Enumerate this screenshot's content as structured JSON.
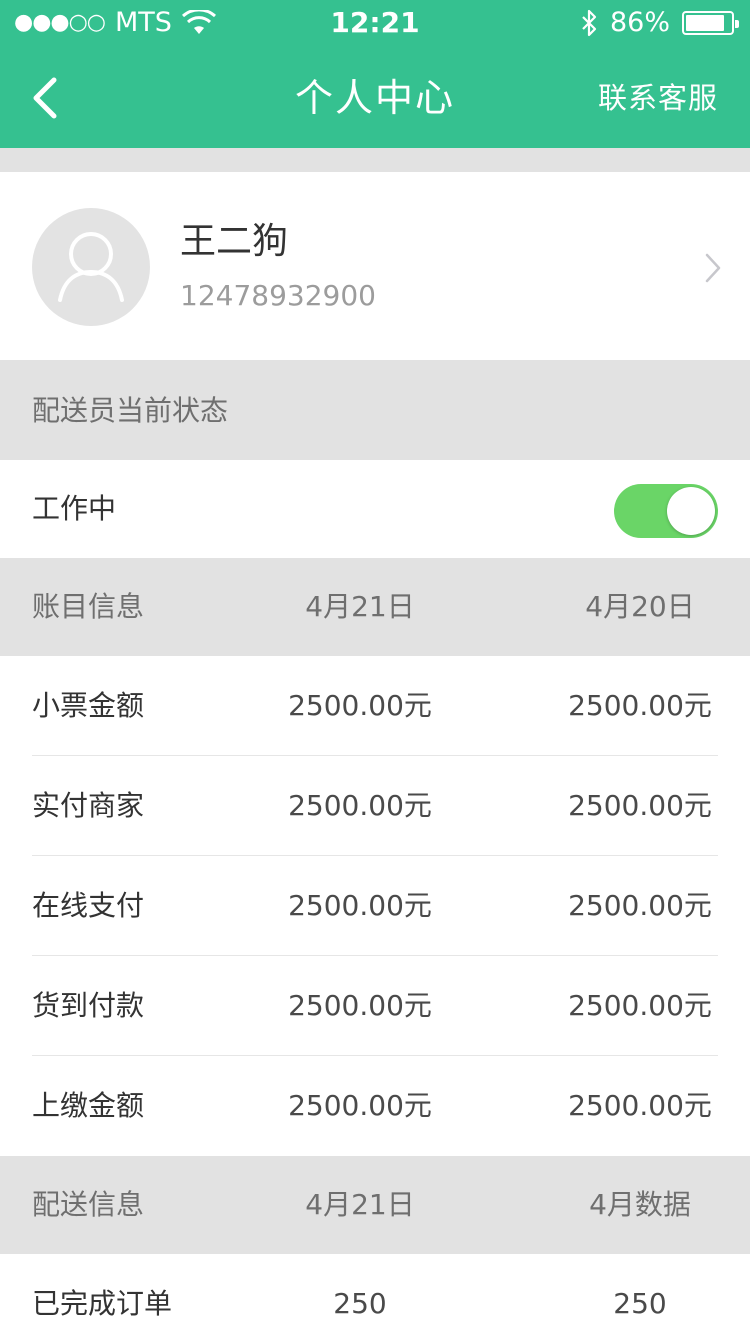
{
  "status_bar": {
    "signal_dots": "●●●○○",
    "carrier": "MTS",
    "time": "12:21",
    "battery_percent": "86%",
    "battery_level": 0.86
  },
  "nav": {
    "title": "个人中心",
    "right_action": "联系客服"
  },
  "profile": {
    "name": "王二狗",
    "phone": "12478932900"
  },
  "status_section": {
    "title": "配送员当前状态",
    "state_label": "工作中",
    "toggle_on": true
  },
  "account_section": {
    "headers": [
      "账目信息",
      "4月21日",
      "4月20日"
    ],
    "rows": [
      {
        "label": "小票金额",
        "v1": "2500.00元",
        "v2": "2500.00元"
      },
      {
        "label": "实付商家",
        "v1": "2500.00元",
        "v2": "2500.00元"
      },
      {
        "label": "在线支付",
        "v1": "2500.00元",
        "v2": "2500.00元"
      },
      {
        "label": "货到付款",
        "v1": "2500.00元",
        "v2": "2500.00元"
      },
      {
        "label": "上缴金额",
        "v1": "2500.00元",
        "v2": "2500.00元"
      }
    ]
  },
  "delivery_section": {
    "headers": [
      "配送信息",
      "4月21日",
      "4月数据"
    ],
    "rows": [
      {
        "label": "已完成订单",
        "v1": "250",
        "v2": "250"
      }
    ]
  },
  "colors": {
    "header_green": "#35c190",
    "toggle_green": "#6ad567",
    "section_bg": "#e2e2e2"
  }
}
